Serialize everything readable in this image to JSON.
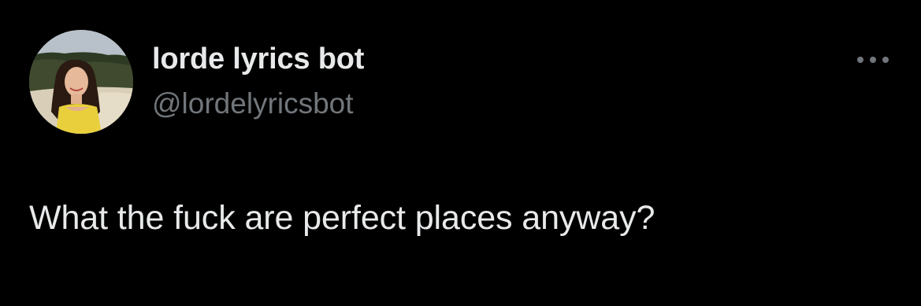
{
  "tweet": {
    "author": {
      "display_name": "lorde lyrics bot",
      "handle": "@lordelyricsbot",
      "avatar_icon": "profile-photo-avatar"
    },
    "text": "What the fuck are perfect places anyway?",
    "menu_icon": "more-options-icon"
  },
  "colors": {
    "background": "#000000",
    "primary_text": "#e7e9ea",
    "secondary_text": "#71767b"
  }
}
